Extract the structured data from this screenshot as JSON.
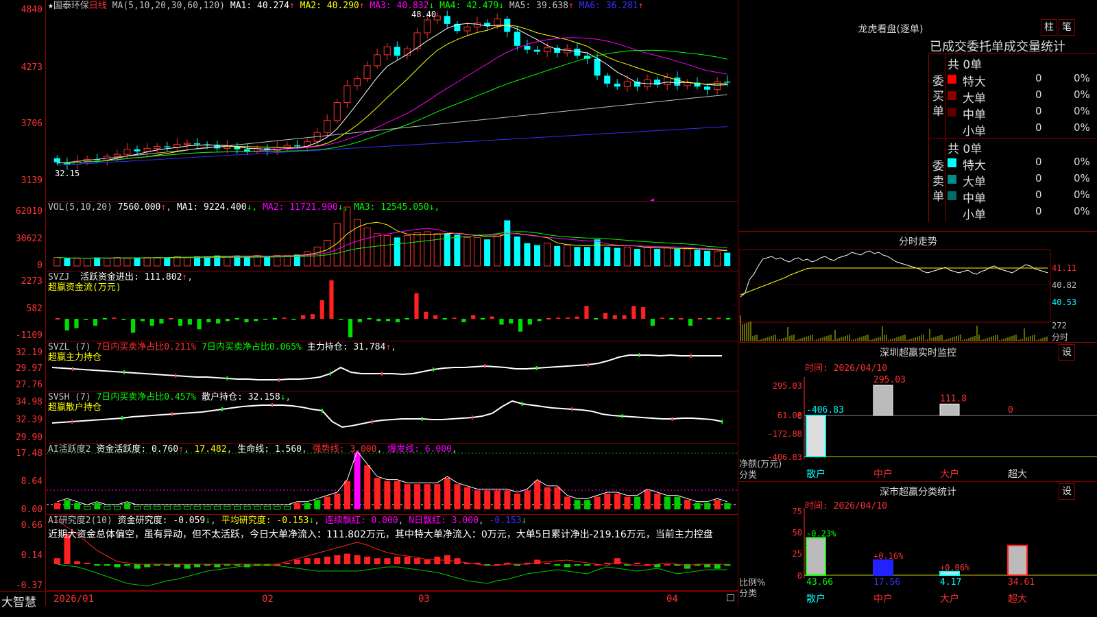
{
  "header": {
    "star": "★",
    "stock_name": "国泰环保",
    "period": "日线",
    "ma_label": "MA(5,10,20,30,60,120)",
    "ma_values": [
      {
        "label": "MA1:",
        "value": "40.274",
        "arrow": "↑",
        "color": "#ffffff"
      },
      {
        "label": "MA2:",
        "value": "40.290",
        "arrow": "↑",
        "color": "#ffff00"
      },
      {
        "label": "MA3:",
        "value": "40.832",
        "arrow": "↓",
        "color": "#ff00ff"
      },
      {
        "label": "MA4:",
        "value": "42.479",
        "arrow": "↓",
        "color": "#00ff00"
      },
      {
        "label": "MA5:",
        "value": "39.638",
        "arrow": "↑",
        "color": "#c0c0c0"
      },
      {
        "label": "MA6:",
        "value": "36.281",
        "arrow": "↑",
        "color": "#3030ff"
      }
    ]
  },
  "price_axis": [
    "4840",
    "4273",
    "3706",
    "3139"
  ],
  "price_annotations": {
    "high": "48.40",
    "low": "32.15"
  },
  "vol": {
    "title": "VOL(5,10,20)",
    "value": "7560.000",
    "arrow": "↑",
    "ma": [
      {
        "label": "MA1:",
        "value": "9224.400",
        "arrow": "↓",
        "color": "#ffffff"
      },
      {
        "label": "MA2:",
        "value": "11721.900",
        "arrow": "↓",
        "color": "#ff00ff"
      },
      {
        "label": "MA3:",
        "value": "12545.050",
        "arrow": "↓",
        "color": "#00ff00"
      }
    ],
    "axis": [
      "62010",
      "30622",
      "0"
    ]
  },
  "svzj": {
    "title": "SVZJ",
    "label": "活跃资金进出:",
    "value": "111.802",
    "arrow": "↑",
    "sub": "超赢资金流(万元)",
    "axis": [
      "2273",
      "582",
      "-1109"
    ]
  },
  "svzl": {
    "title": "SVZL (7)",
    "sell": "7日内买卖净占比0.211%",
    "buy": "7日内买卖净占比0.065%",
    "hold_label": "主力持仓:",
    "hold": "31.784",
    "arrow": "↑",
    "sub": "超赢主力持仓",
    "axis": [
      "32.19",
      "29.97",
      "27.76"
    ]
  },
  "svsh": {
    "title": "SVSH (7)",
    "ratio": "7日内买卖净占比0.457%",
    "hold_label": "散户持仓:",
    "hold": "32.158",
    "arrow": "↓",
    "sub": "超赢散户持仓",
    "axis": [
      "34.98",
      "32.39",
      "29.90"
    ]
  },
  "ai1": {
    "title": "AI活跃度2",
    "label": "资金活跃度:",
    "value": "0.760",
    "v2": "17.482",
    "life_label": "生命线:",
    "life": "1.560",
    "strong": "强势线: 3.000",
    "burst": "爆发线: 6.000",
    "axis": [
      "17.48",
      "8.64",
      "0.00"
    ]
  },
  "ai2": {
    "title": "AI研究度2(10)",
    "label": "资金研究度:",
    "value": "-0.059",
    "avg_label": "平均研究度:",
    "avg": "-0.153",
    "red_label": "连续飘红:",
    "red": "0.000",
    "nred_label": "N日飘红:",
    "nred": "3.000",
    "v5": "-0.153",
    "axis": [
      "0.66",
      "0.14",
      "-0.37"
    ],
    "comment": "近期大资金总体偏空，虽有异动，但不太活跃，今日大单净流入：111.802万元，其中特大单净流入：0万元，大单5日累计净出-219.16万元，当前主力控盘"
  },
  "footer": {
    "brand": "大智慧",
    "dates": [
      "2026/01",
      "02",
      "03",
      "04"
    ]
  },
  "dragon": {
    "title": "龙虎看盘(逐单)",
    "btn1": "柱",
    "btn2": "笔",
    "subtitle": "已成交委托单成交量统计",
    "buy_label": "委买单",
    "sell_label": "委卖单",
    "buy_total": "共 0单",
    "sell_total": "共 0单",
    "buy_rows": [
      {
        "name": "特大",
        "val": "0",
        "pct": "0%",
        "color": "#ff0000"
      },
      {
        "name": "大单",
        "val": "0",
        "pct": "0%",
        "color": "#8b0000"
      },
      {
        "name": "中单",
        "val": "0",
        "pct": "0%",
        "color": "#5a0000"
      },
      {
        "name": "小单",
        "val": "0",
        "pct": "0%",
        "color": "#000000"
      }
    ],
    "sell_rows": [
      {
        "name": "特大",
        "val": "0",
        "pct": "0%",
        "color": "#00ffff"
      },
      {
        "name": "大单",
        "val": "0",
        "pct": "0%",
        "color": "#008b8b"
      },
      {
        "name": "中单",
        "val": "0",
        "pct": "0%",
        "color": "#006b6b"
      },
      {
        "name": "小单",
        "val": "0",
        "pct": "0%",
        "color": "#000000"
      }
    ]
  },
  "intraday": {
    "title": "分时走势",
    "axis": [
      "41.11",
      "40.82",
      "40.53"
    ],
    "vol_label": "272",
    "vol_unit": "分时"
  },
  "monitor": {
    "title": "深圳超赢实时监控",
    "btn": "设",
    "time": "时间: 2026/04/10",
    "axis": [
      "295.03",
      "61.08",
      "0",
      "-172.88",
      "-406.83"
    ],
    "unit": "净额(万元)",
    "cat_label": "分类",
    "bars": [
      {
        "name": "散户",
        "value": -406.83,
        "label": "-406.83"
      },
      {
        "name": "中户",
        "value": 295.03,
        "label": "295.03"
      },
      {
        "name": "大户",
        "value": 111.8,
        "label": "111.8"
      },
      {
        "name": "超大",
        "value": 0,
        "label": "0"
      }
    ]
  },
  "classify": {
    "title": "深市超赢分类统计",
    "btn": "设",
    "time": "时间: 2026/04/10",
    "axis": [
      "75",
      "50",
      "25",
      "0"
    ],
    "unit": "比例%",
    "cat_label": "分类",
    "bars": [
      {
        "name": "散户",
        "value": 43.66,
        "label": "43.66",
        "pct": "-0.23%"
      },
      {
        "name": "中户",
        "value": 17.56,
        "label": "17.56",
        "pct": "+0.16%"
      },
      {
        "name": "大户",
        "value": 4.17,
        "label": "4.17",
        "pct": "+0.06%"
      },
      {
        "name": "超大",
        "value": 34.61,
        "label": "34.61",
        "pct": ""
      }
    ]
  }
}
